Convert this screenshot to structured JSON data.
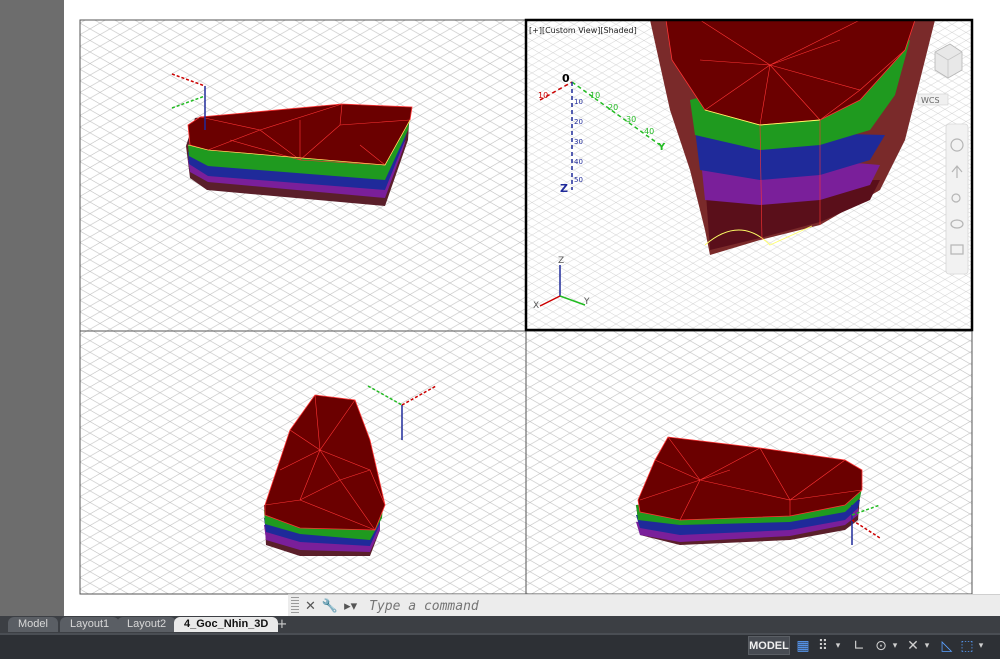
{
  "viewport_label": "[+][Custom View][Shaded]",
  "viewcube": {
    "wcs_label": "WCS"
  },
  "axes": {
    "x": "X",
    "y": "Y",
    "z": "Z"
  },
  "ruler_labels": {
    "zero": "0",
    "left": "10",
    "y_ticks": [
      "10",
      "20",
      "30",
      "40",
      "Y"
    ],
    "z_ticks": [
      "10",
      "20",
      "30",
      "40",
      "50",
      "Z"
    ]
  },
  "command_line": {
    "placeholder": "Type a command",
    "close_icon": "close-icon",
    "settings_icon": "wrench-icon",
    "prompt_icon": "command-prompt-icon"
  },
  "tabs": [
    {
      "label": "Model"
    },
    {
      "label": "Layout1"
    },
    {
      "label": "Layout2"
    },
    {
      "label": "4_Goc_Nhin_3D"
    }
  ],
  "active_tab": "4_Goc_Nhin_3D",
  "status_bar": {
    "model_label": "MODEL",
    "icons": [
      "grid-icon",
      "snap-icon",
      "ortho-icon",
      "polar-icon",
      "osnap-icon",
      "annotation-icon"
    ]
  },
  "colors": {
    "surface_top": "#6b0000",
    "mesh_line": "#ff3333",
    "band_green": "#1f9a1f",
    "band_blue": "#1f2a9a",
    "band_purple": "#7a1f9a",
    "grid": "#b8b8b8",
    "active_border": "#000000"
  }
}
